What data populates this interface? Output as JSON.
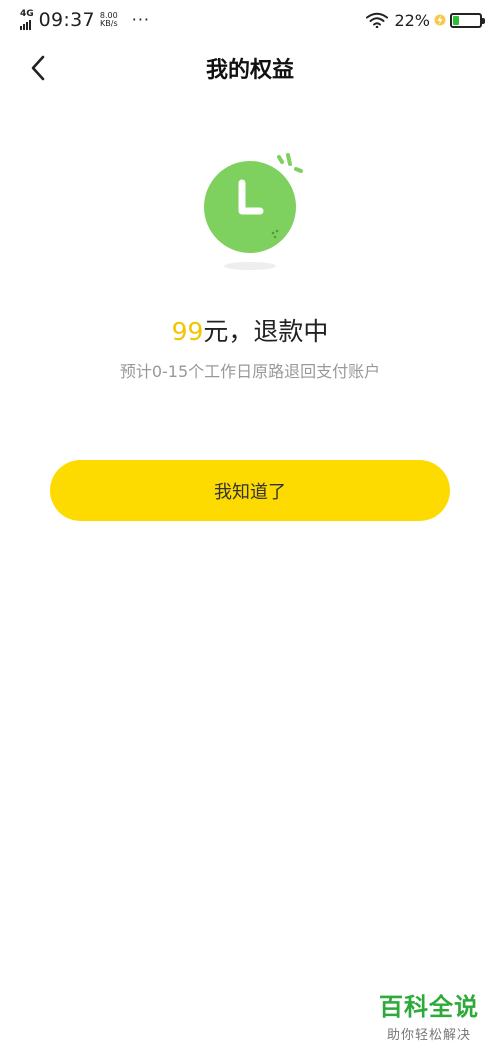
{
  "status_bar": {
    "network": "4G",
    "time": "09:37",
    "speed_value": "8.00",
    "speed_unit": "KB/s",
    "more": "···",
    "battery_percent": "22%",
    "battery_level": 0.22,
    "icons": [
      "signal-icon",
      "wifi-icon",
      "charging-icon",
      "battery-icon"
    ]
  },
  "nav": {
    "back_icon": "chevron-left-icon",
    "title": "我的权益"
  },
  "illustration": {
    "icon": "clock-icon",
    "color": "#7ed15e"
  },
  "refund": {
    "amount": "99",
    "status_text": "元，退款中",
    "hint": "预计0-15个工作日原路退回支付账户",
    "amount_color": "#f3c400"
  },
  "button": {
    "label": "我知道了",
    "color": "#fedb00"
  },
  "watermark": {
    "title": "百科全说",
    "subtitle": "助你轻松解决"
  }
}
